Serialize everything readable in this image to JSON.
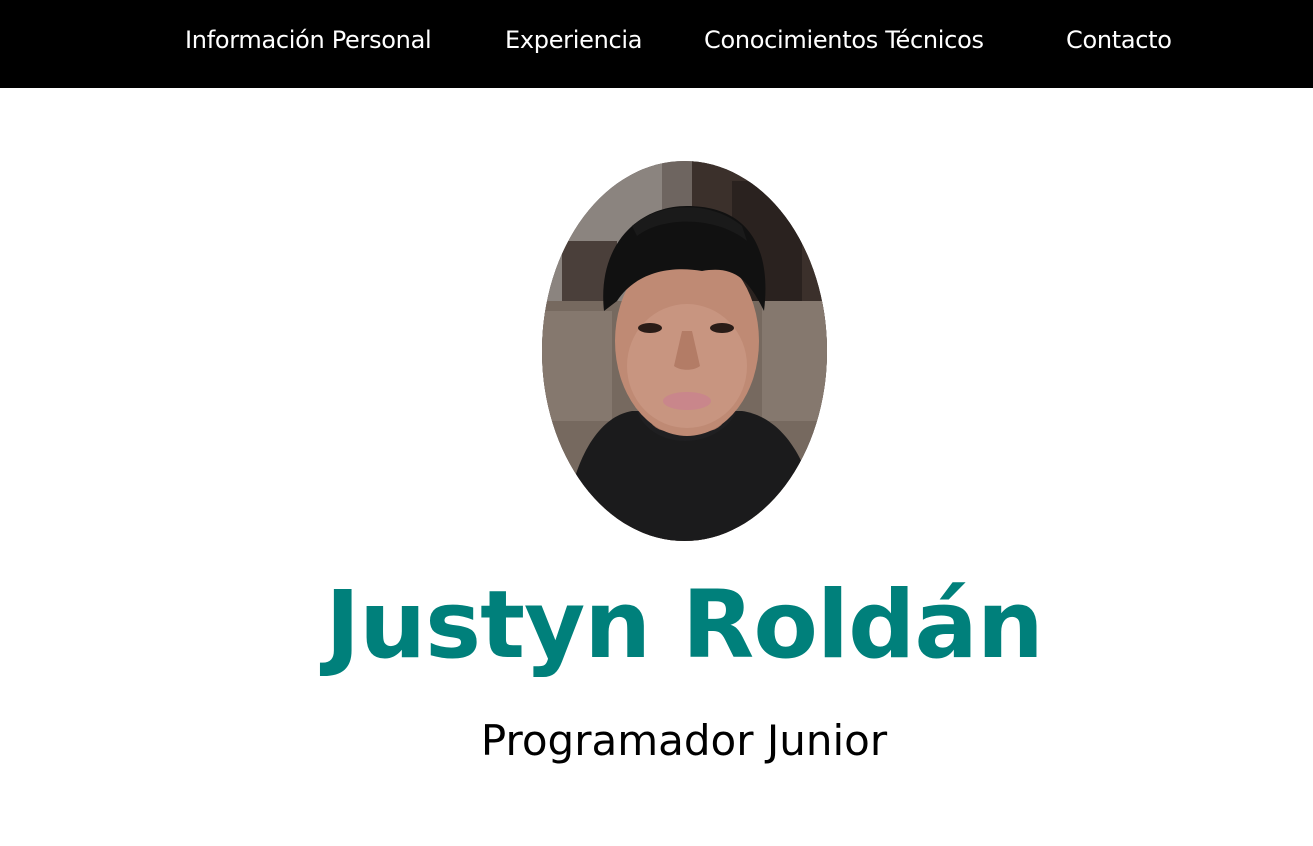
{
  "nav": {
    "items": [
      {
        "label": "Información Personal"
      },
      {
        "label": "Experiencia"
      },
      {
        "label": "Conocimientos Técnicos"
      },
      {
        "label": "Contacto"
      }
    ]
  },
  "profile": {
    "photo_icon": "profile-photo",
    "name": "Justyn Roldán",
    "title": "Programador Junior",
    "accent_color": "#00807b"
  },
  "colors": {
    "nav_background": "#000000",
    "nav_text": "#ffffff",
    "page_background": "#ffffff",
    "subtitle_text": "#000000"
  }
}
